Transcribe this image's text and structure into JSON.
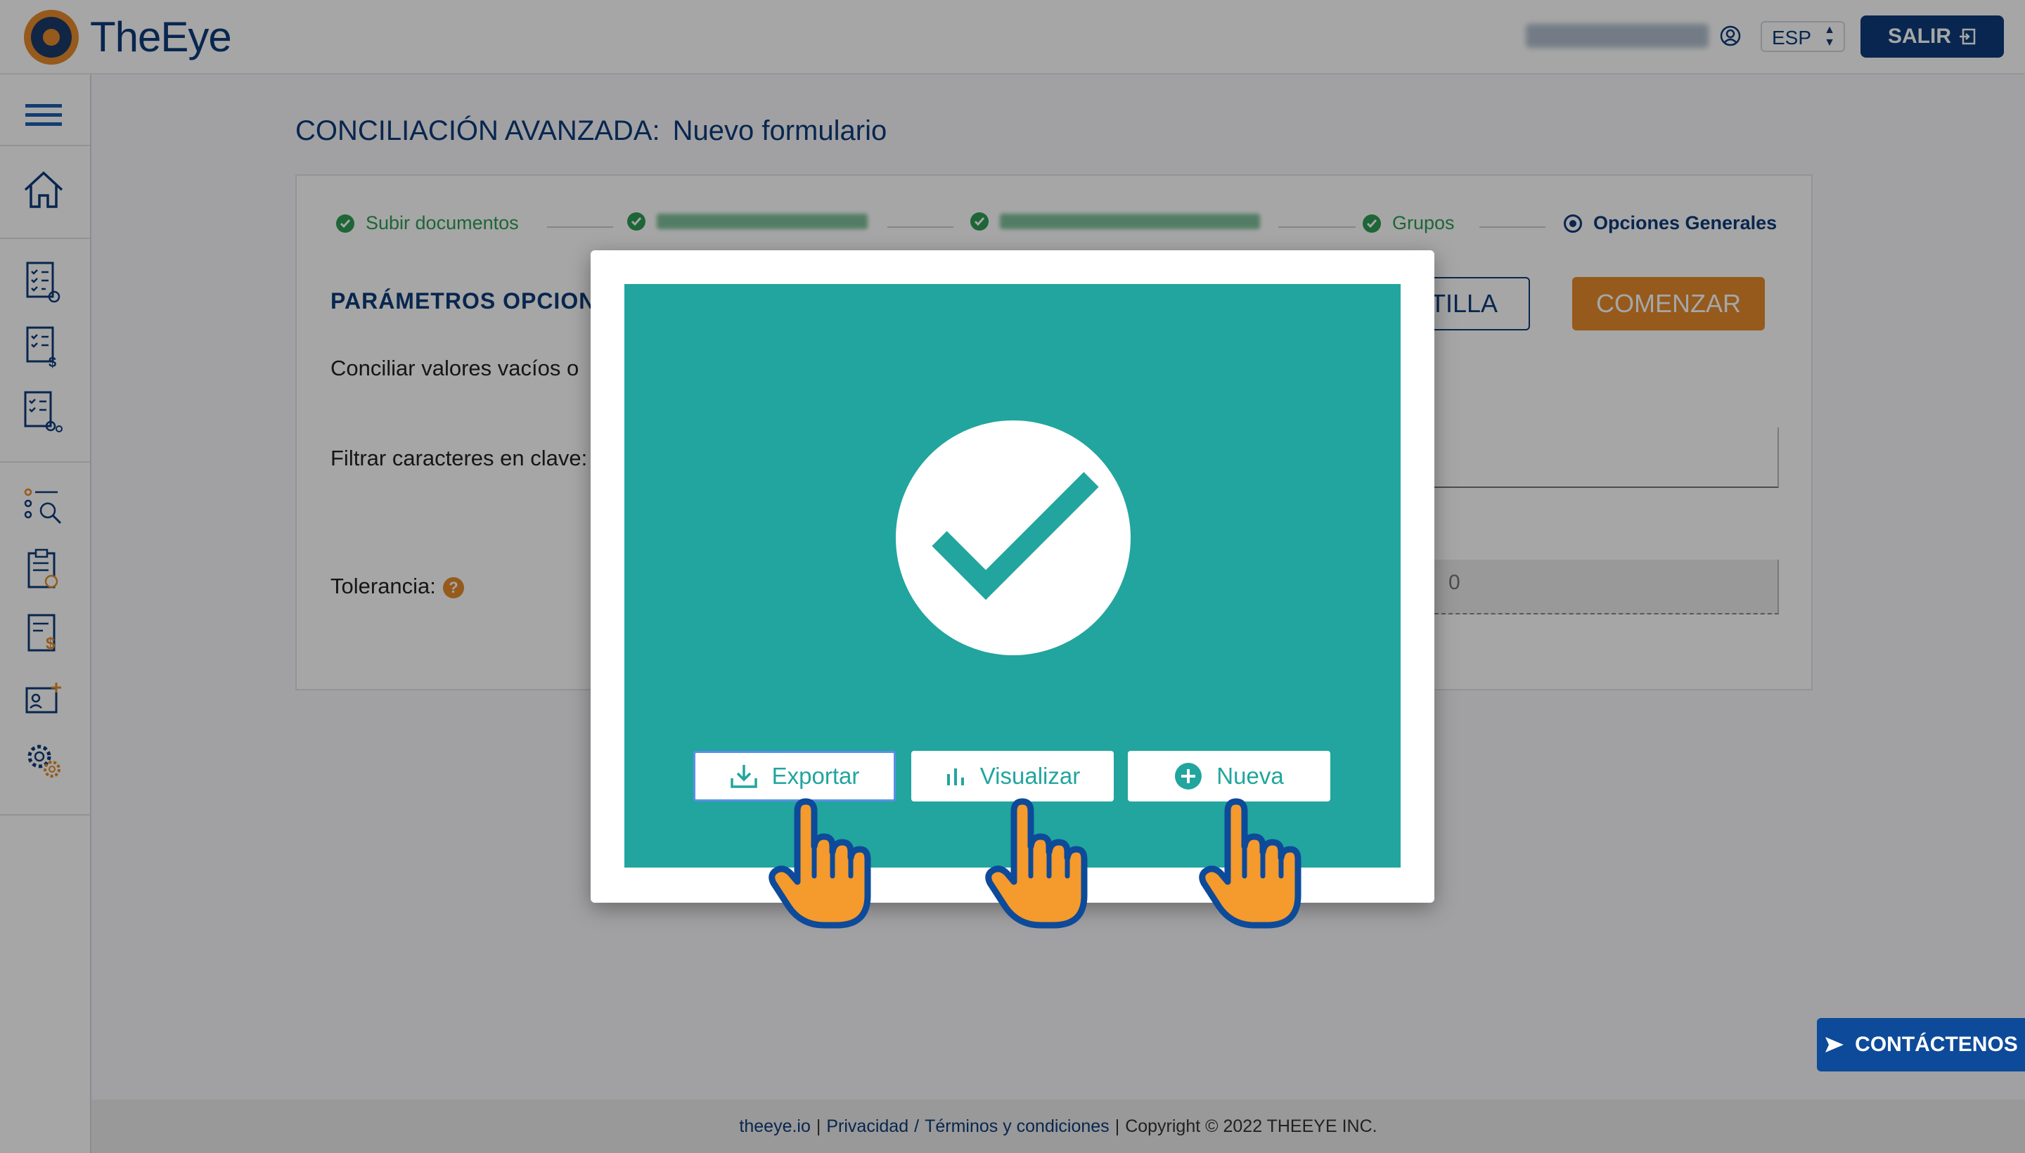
{
  "app": {
    "name": "TheEye"
  },
  "header": {
    "language": "ESP",
    "logout_label": "SALIR"
  },
  "page": {
    "title": "CONCILIACIÓN AVANZADA:",
    "subtitle": "Nuevo formulario"
  },
  "stepper": {
    "steps": [
      {
        "label": "Subir documentos",
        "state": "done"
      },
      {
        "label": "",
        "state": "done"
      },
      {
        "label": "",
        "state": "done"
      },
      {
        "label": "Grupos",
        "state": "done"
      },
      {
        "label": "Opciones Generales",
        "state": "active"
      }
    ]
  },
  "form": {
    "section_title": "PARÁMETROS OPCION",
    "template_button_partial": "TILLA",
    "start_button": "COMENZAR",
    "empty_values_label": "Conciliar valores vacíos o",
    "filter_label": "Filtrar caracteres en clave:",
    "tolerance_label": "Tolerancia:",
    "tolerance_help": "?",
    "tolerance_value": "0"
  },
  "modal": {
    "status": "success",
    "buttons": {
      "export": "Exportar",
      "visualize": "Visualizar",
      "new": "Nueva"
    }
  },
  "contact_button": "CONTÁCTENOS",
  "footer": {
    "site": "theeye.io",
    "sep1": "|",
    "privacy": "Privacidad",
    "slash": "/",
    "terms": "Términos y condiciones",
    "sep2": "|",
    "copyright": "Copyright © 2022 THEEYE INC."
  },
  "colors": {
    "brand_blue": "#0d3b7a",
    "brand_orange": "#e58a2c",
    "success_teal": "#21a59e",
    "step_green": "#2e9c55"
  }
}
